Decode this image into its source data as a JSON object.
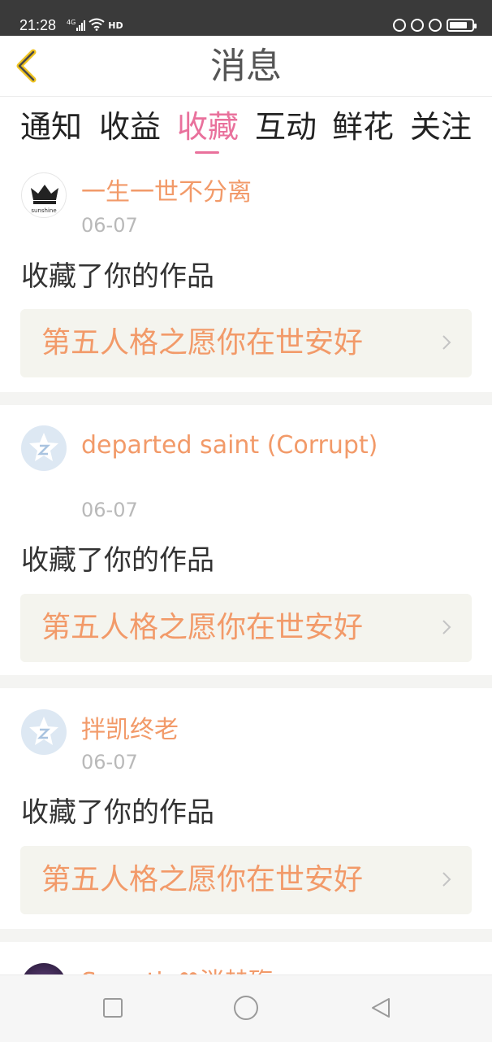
{
  "status_bar": {
    "time": "21:28",
    "network": "4G",
    "hd_label": "HD",
    "battery_level": 0.8,
    "icons": [
      "signal-icon",
      "wifi-icon",
      "hd-icon",
      "do-not-disturb-icon",
      "lock-icon",
      "alarm-icon",
      "battery-icon"
    ]
  },
  "header": {
    "title": "消息",
    "back_icon": "chevron-left-icon",
    "accent_color": "#f0c420"
  },
  "tabs": [
    {
      "label": "通知",
      "active": false
    },
    {
      "label": "收益",
      "active": false
    },
    {
      "label": "收藏",
      "active": true
    },
    {
      "label": "互动",
      "active": false
    },
    {
      "label": "鲜花",
      "active": false
    },
    {
      "label": "关注",
      "active": false
    }
  ],
  "active_color": "#e9719c",
  "messages": [
    {
      "user_name": "一生一世不分离",
      "avatar": "crown-avatar",
      "avatar_text": "sunshine",
      "date": "06-07",
      "action": "收藏了你的作品",
      "work_title": "第五人格之愿你在世安好"
    },
    {
      "user_name": "departed saint (Corrupt)",
      "avatar": "default-avatar",
      "date": "06-07",
      "action": "收藏了你的作品",
      "work_title": "第五人格之愿你在世安好"
    },
    {
      "user_name": "拌凯终老",
      "avatar": "default-avatar",
      "date": "06-07",
      "action": "收藏了你的作品",
      "work_title": "第五人格之愿你在世安好"
    },
    {
      "user_name": "Sweetie♥消赫殇",
      "avatar": "dark-avatar"
    }
  ],
  "colors": {
    "name": "#f29a69",
    "date": "#b9b9b9",
    "work_box_bg": "#f4f4ee"
  },
  "nav_bar": {
    "buttons": [
      "recent-apps-icon",
      "home-icon",
      "back-triangle-icon"
    ]
  }
}
